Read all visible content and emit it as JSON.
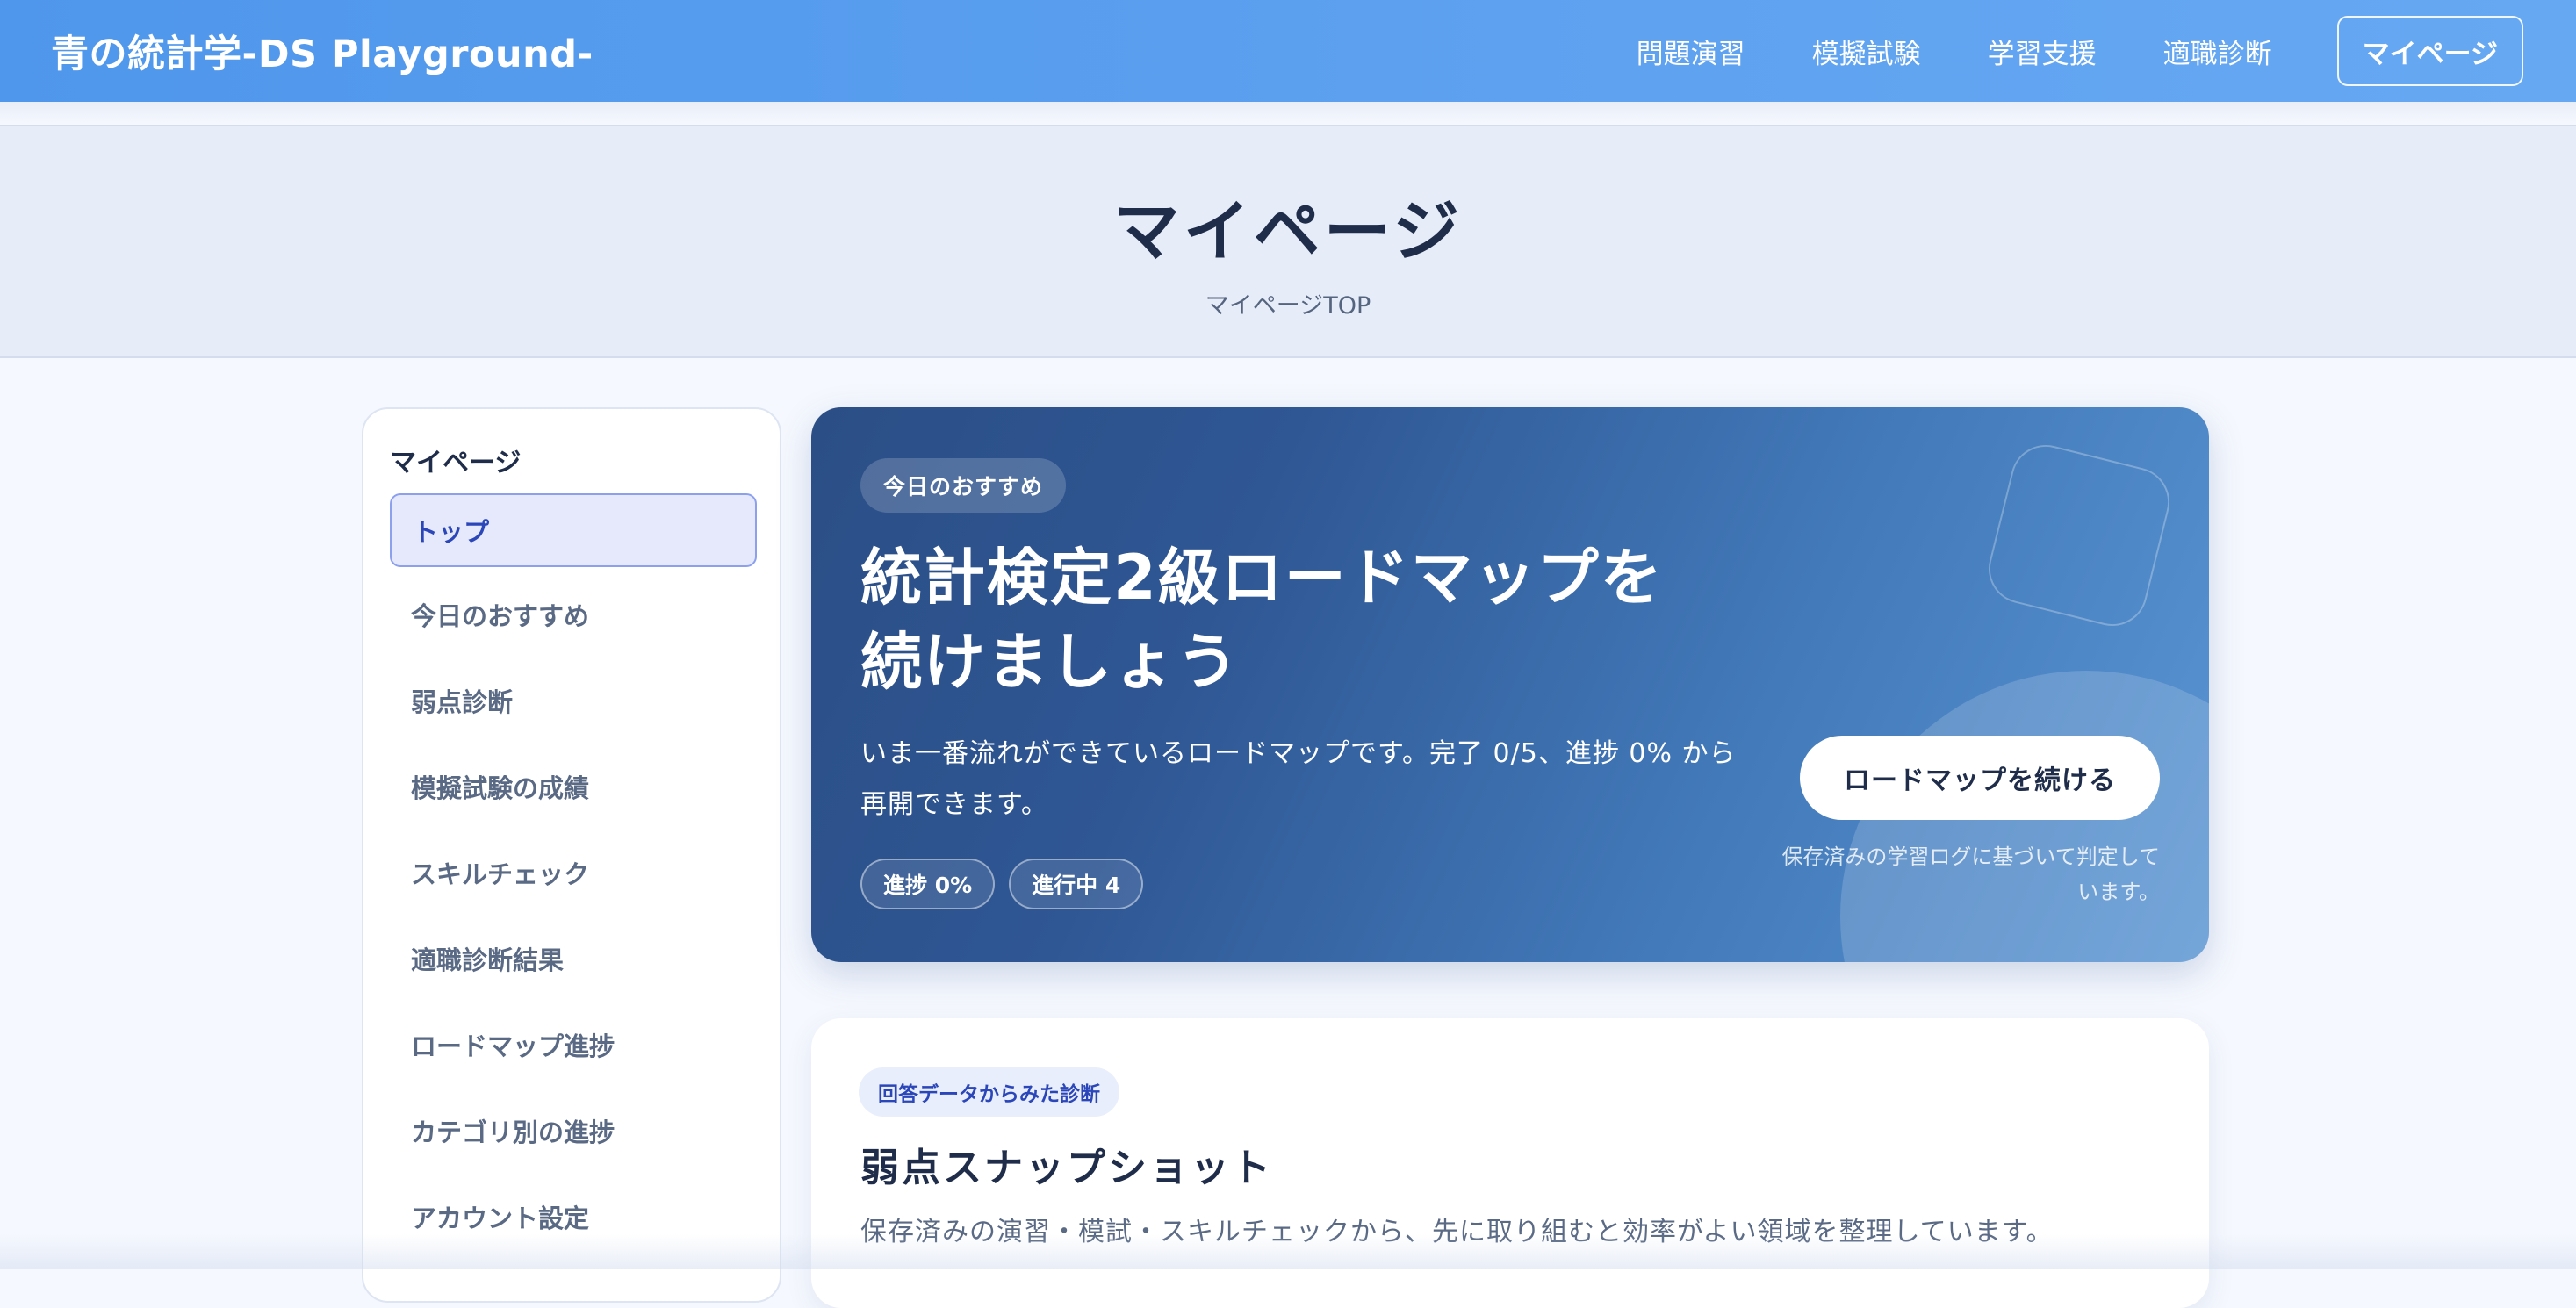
{
  "header": {
    "brand": "青の統計学-DS Playground-",
    "nav": [
      "問題演習",
      "模擬試験",
      "学習支援",
      "適職診断"
    ],
    "mypage_button": "マイページ"
  },
  "page": {
    "title": "マイページ",
    "breadcrumb": "マイページTOP"
  },
  "sidebar": {
    "title": "マイページ",
    "items": [
      {
        "label": "トップ",
        "active": true
      },
      {
        "label": "今日のおすすめ"
      },
      {
        "label": "弱点診断"
      },
      {
        "label": "模擬試験の成績"
      },
      {
        "label": "スキルチェック"
      },
      {
        "label": "適職診断結果"
      },
      {
        "label": "ロードマップ進捗"
      },
      {
        "label": "カテゴリ別の進捗"
      },
      {
        "label": "アカウント設定"
      }
    ]
  },
  "recommend": {
    "badge": "今日のおすすめ",
    "title_line1": "統計検定2級ロードマップを",
    "title_line2": "続けましょう",
    "desc": "いま一番流れができているロードマップです。完了 0/5、進捗 0% から再開できます。",
    "chips": [
      "進捗 0%",
      "進行中 4"
    ],
    "button": "ロードマップを続ける",
    "note": "保存済みの学習ログに基づいて判定しています。"
  },
  "snapshot": {
    "badge": "回答データからみた診断",
    "title": "弱点スナップショット",
    "desc": "保存済みの演習・模試・スキルチェックから、先に取り組むと効率がよい領域を整理しています。"
  },
  "colors": {
    "header": "#4f97ec",
    "accent": "#2b46b9",
    "card_dark": "#2b4e86"
  }
}
